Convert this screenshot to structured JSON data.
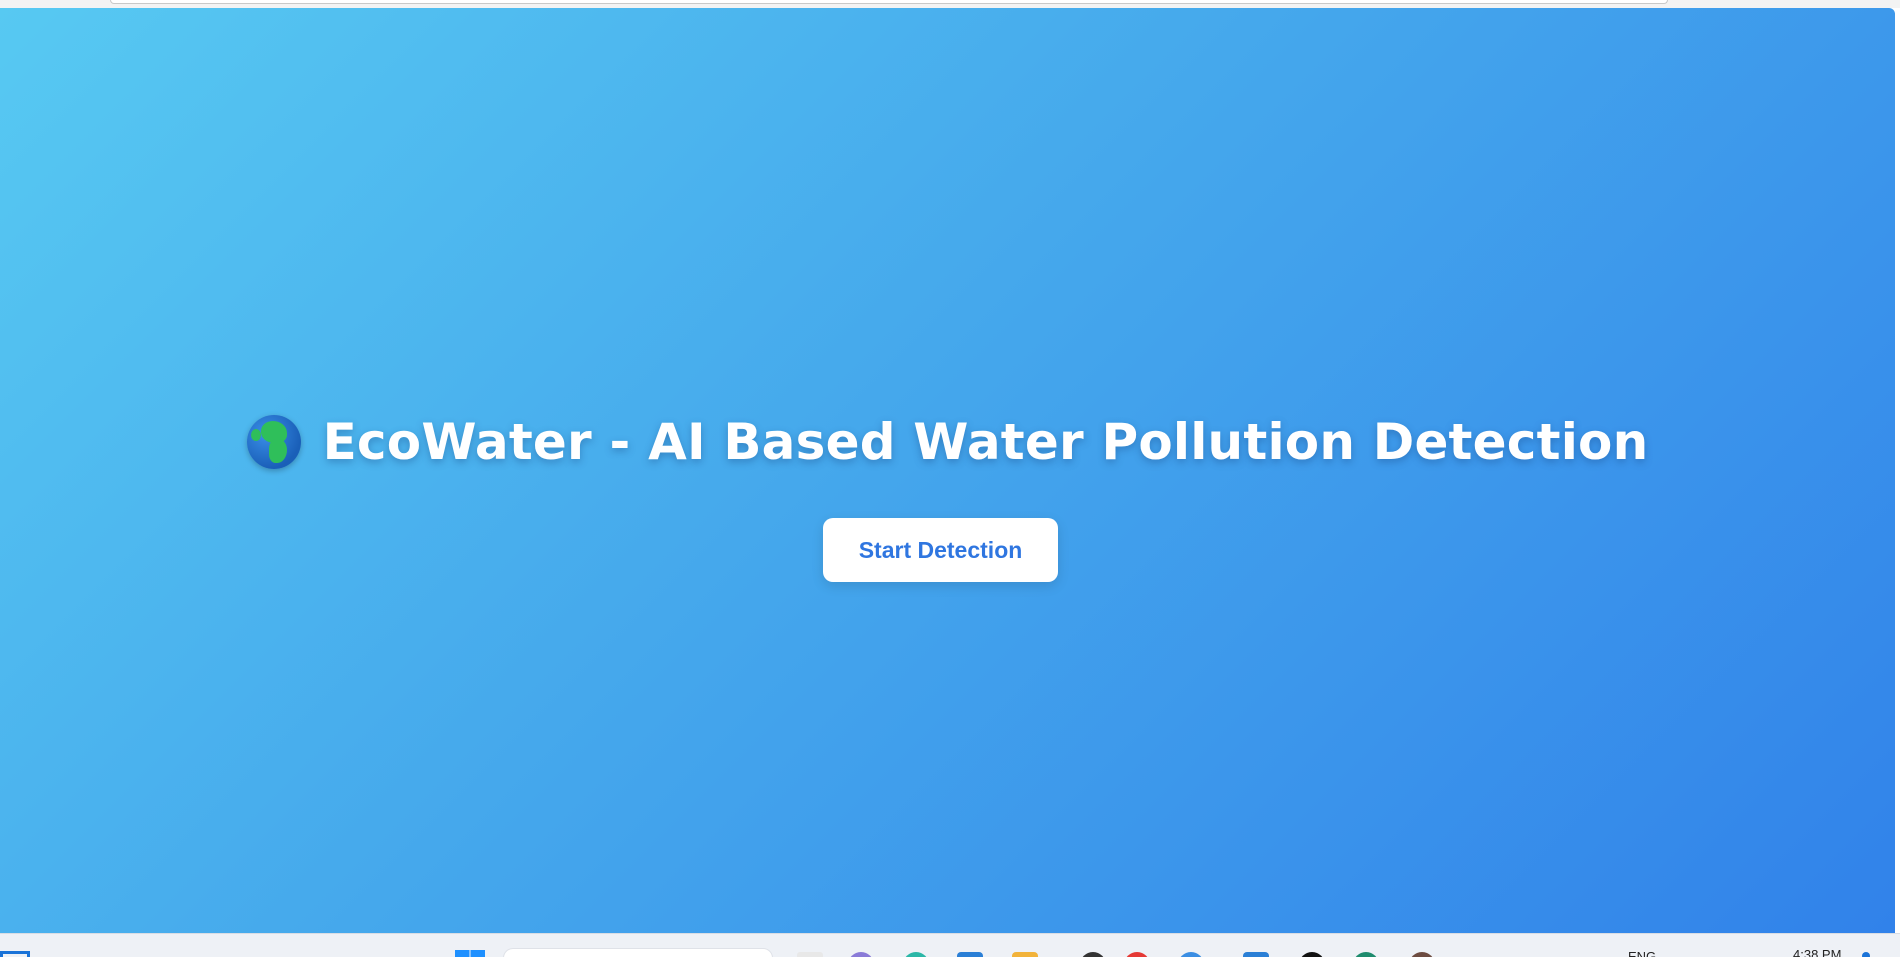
{
  "page": {
    "title": "EcoWater - AI Based Water Pollution Detection",
    "start_button_label": "Start Detection",
    "globe_emoji": "globe-icon",
    "colors": {
      "gradient_start": "#57c9f2",
      "gradient_end": "#3182ea",
      "button_text": "#2f76e0",
      "title_text": "#ffffff"
    }
  },
  "taskbar": {
    "language": "ENG",
    "time": "4:38 PM",
    "apps": [
      {
        "name": "mail-app-icon",
        "color": "#e8e8e8"
      },
      {
        "name": "teams-app-icon",
        "color": "#8a7bd8"
      },
      {
        "name": "edge-app-icon",
        "color": "#2bb7a7"
      },
      {
        "name": "store-app-icon",
        "color": "#2a7fd6"
      },
      {
        "name": "file-explorer-icon",
        "color": "#f2b33a"
      },
      {
        "name": "media-app-icon",
        "color": "#333333"
      },
      {
        "name": "red-app-icon",
        "color": "#e53935"
      },
      {
        "name": "chrome-app-icon",
        "color": "#3b8ee3"
      },
      {
        "name": "vscode-app-icon",
        "color": "#2a7fd6"
      },
      {
        "name": "dark-app-icon",
        "color": "#111111"
      },
      {
        "name": "profile-b-icon",
        "color": "#1e8c6e"
      },
      {
        "name": "profile-e-icon",
        "color": "#6d4c41"
      }
    ]
  }
}
